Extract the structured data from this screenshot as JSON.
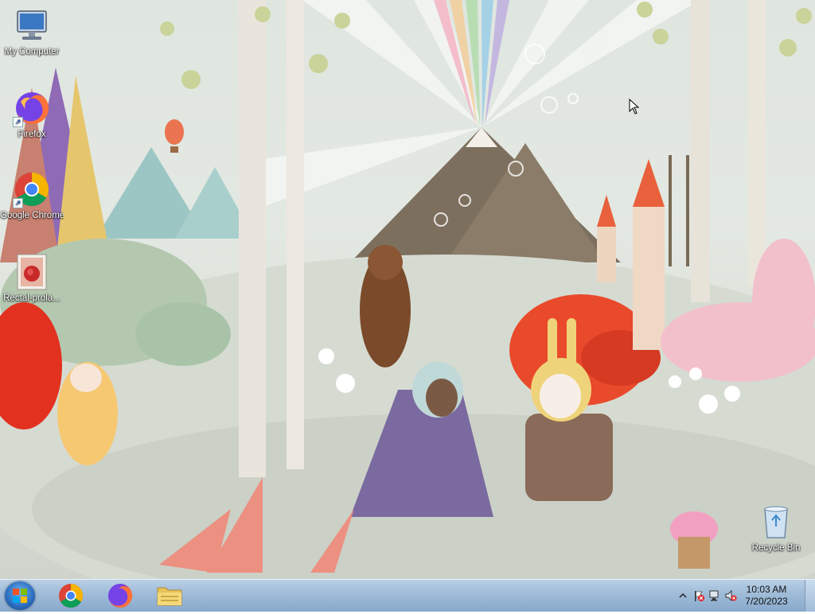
{
  "desktop": {
    "icons": [
      {
        "label": "My Computer",
        "icon": "computer-icon"
      },
      {
        "label": "Firefox",
        "icon": "firefox-icon"
      },
      {
        "label": "Google Chrome",
        "icon": "chrome-icon"
      },
      {
        "label": "Rectal-prola...",
        "icon": "image-file-icon"
      },
      {
        "label": "Recycle Bin",
        "icon": "recycle-bin-icon"
      }
    ]
  },
  "taskbar": {
    "pinned": [
      {
        "name": "Google Chrome",
        "icon": "chrome-icon"
      },
      {
        "name": "Firefox",
        "icon": "firefox-icon"
      },
      {
        "name": "Windows Explorer",
        "icon": "folder-icon"
      }
    ],
    "tray": {
      "time": "10:03 AM",
      "date": "7/20/2023",
      "icons": [
        "show-hidden-icons-chevron",
        "action-center-flag-icon",
        "network-icon",
        "volume-muted-icon"
      ]
    }
  },
  "colors": {
    "taskbar": "#9fbbd8",
    "wallpaper_background": "#dfe6df",
    "accent_orange": "#e8542a",
    "accent_pink": "#f0a4b6"
  }
}
